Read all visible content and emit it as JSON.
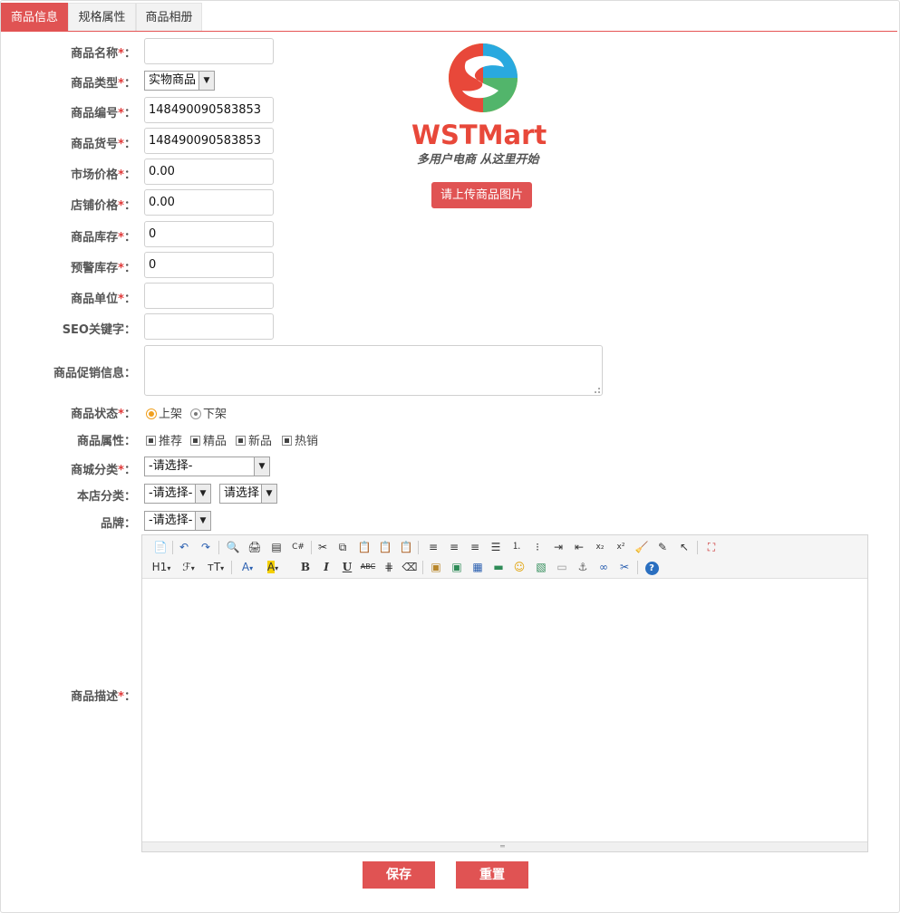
{
  "tabs": [
    "商品信息",
    "规格属性",
    "商品相册"
  ],
  "form": {
    "name_label": "商品名称",
    "type_label": "商品类型",
    "type_value": "实物商品",
    "sn_label": "商品编号",
    "sn_value": "148490090583853",
    "product_no_label": "商品货号",
    "product_no_value": "148490090583853",
    "market_price_label": "市场价格",
    "market_price_value": "0.00",
    "shop_price_label": "店铺价格",
    "shop_price_value": "0.00",
    "stock_label": "商品库存",
    "stock_value": "0",
    "warn_stock_label": "预警库存",
    "warn_stock_value": "0",
    "unit_label": "商品单位",
    "seo_label": "SEO关键字",
    "promo_label": "商品促销信息",
    "status_label": "商品状态",
    "status_on": "上架",
    "status_off": "下架",
    "attr_label": "商品属性",
    "attr_recommend": "推荐",
    "attr_best": "精品",
    "attr_new": "新品",
    "attr_hot": "热销",
    "mall_cat_label": "商城分类",
    "mall_cat_value": "-请选择-",
    "shop_cat_label": "本店分类",
    "shop_cat_value_1": "-请选择-",
    "shop_cat_value_2": "请选择",
    "brand_label": "品牌",
    "brand_value": "-请选择-",
    "desc_label": "商品描述",
    "required_mark": "*",
    "colon": "："
  },
  "logo": {
    "brand": "WSTMart",
    "slogan": "多用户电商  从这里开始"
  },
  "upload_button": "请上传商品图片",
  "editor": {
    "row2_labels": [
      "H1",
      "ℱ",
      "тT",
      "A",
      "A",
      "B",
      "I",
      "U",
      "ABC"
    ]
  },
  "actions": {
    "save": "保存",
    "reset": "重置"
  },
  "colors": {
    "accent": "#e05353",
    "required": "#e03a3a"
  }
}
